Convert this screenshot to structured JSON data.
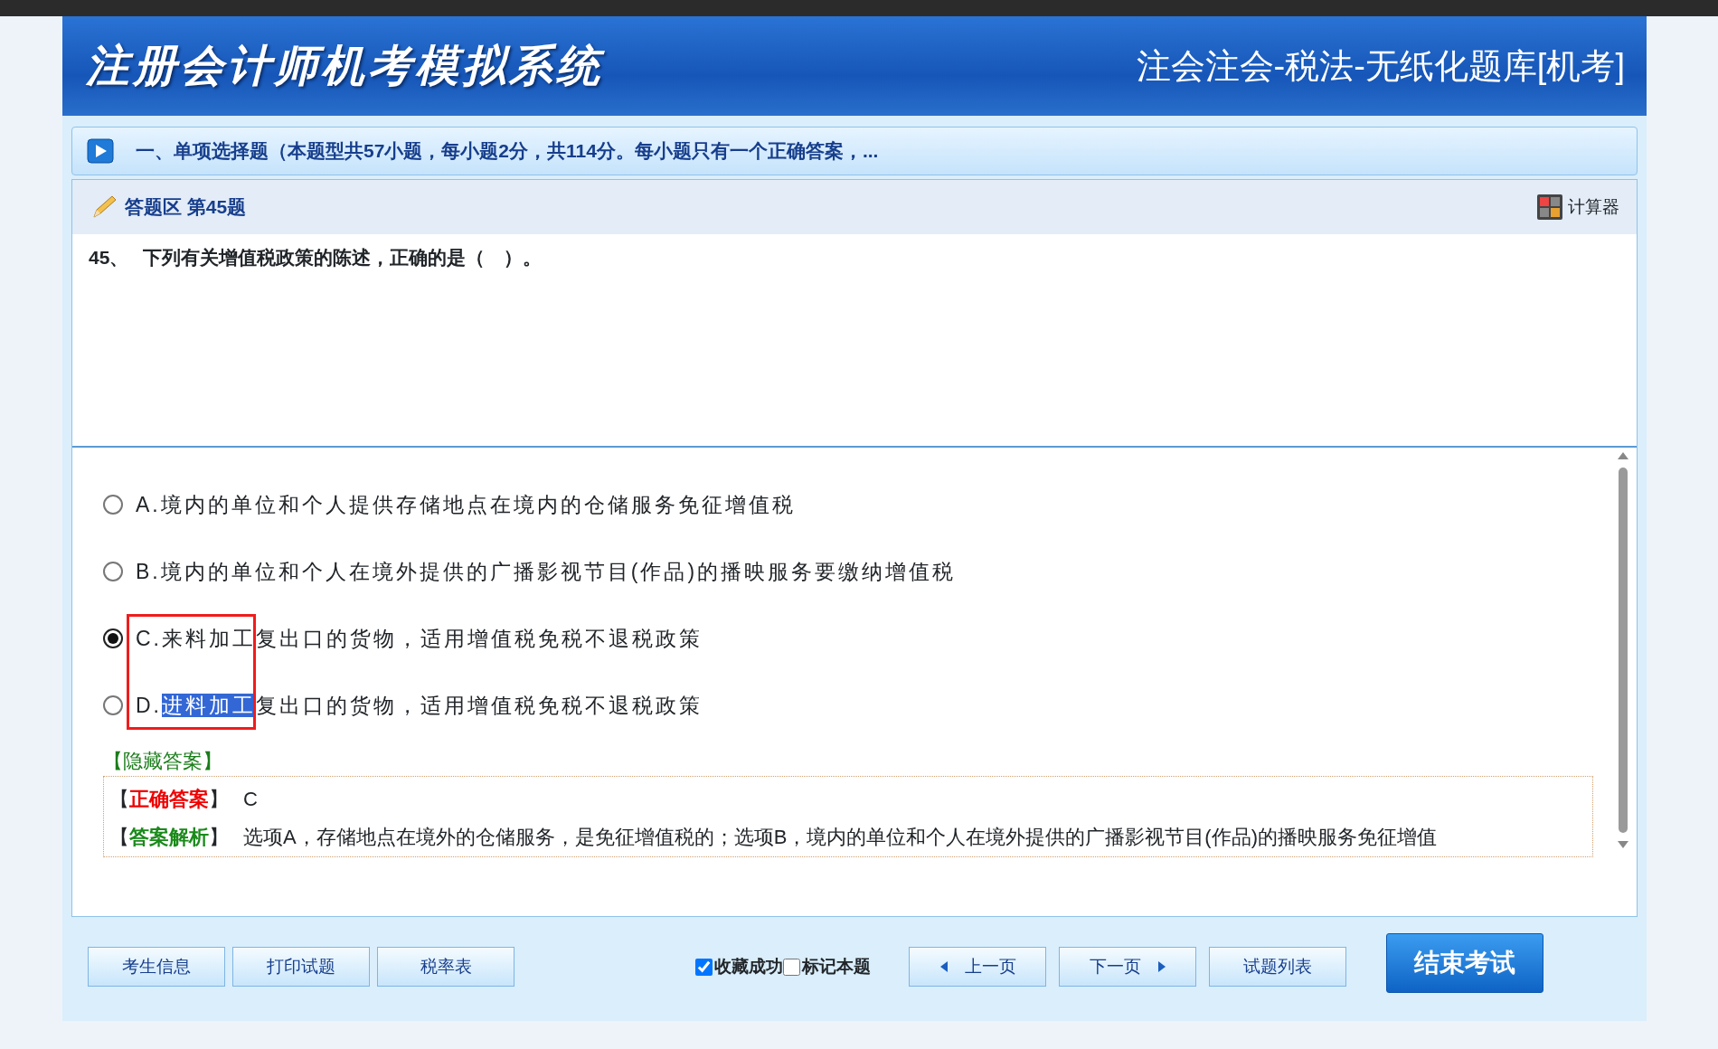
{
  "header": {
    "system_title": "注册会计师机考模拟系统",
    "exam_title": "注会注会-税法-无纸化题库[机考]"
  },
  "section": {
    "title": "一、单项选择题（本题型共57小题，每小题2分，共114分。每小题只有一个正确答案，..."
  },
  "answer_area": {
    "label": "答题区 第45题",
    "calculator": "计算器"
  },
  "question": {
    "number": "45、",
    "text": "下列有关增值税政策的陈述，正确的是（　）。"
  },
  "options": [
    {
      "letter": "A.",
      "text": "境内的单位和个人提供存储地点在境内的仓储服务免征增值税",
      "selected": false
    },
    {
      "letter": "B.",
      "text": "境内的单位和个人在境外提供的广播影视节目(作品)的播映服务要缴纳增值税",
      "selected": false
    },
    {
      "letter": "C.",
      "text": "来料加工复出口的货物，适用增值税免税不退税政策",
      "selected": true
    },
    {
      "letter": "D.",
      "highlighted": "进料加工",
      "text": "复出口的货物，适用增值税免税不退税政策",
      "selected": false
    }
  ],
  "hide_answer_link": "【隐藏答案】",
  "answer_lines": [
    {
      "kind": "correct",
      "bracket_open": "【",
      "label": "正确答案",
      "bracket_close": "】",
      "text": "C"
    },
    {
      "kind": "analysis",
      "bracket_open": "【",
      "label": "答案解析",
      "bracket_close": "】",
      "text": "选项A，存储地点在境外的仓储服务，是免征增值税的；选项B，境内的单位和个人在境外提供的广播影视节目(作品)的播映服务免征增值"
    }
  ],
  "left_buttons": [
    {
      "label": "考生信息"
    },
    {
      "label": "打印试题"
    },
    {
      "label": "税率表"
    }
  ],
  "checkboxes": [
    {
      "label": "收藏成功",
      "checked": true
    },
    {
      "label": "标记本题",
      "checked": false
    }
  ],
  "nav_buttons": [
    {
      "kind": "prev",
      "label": "上一页"
    },
    {
      "kind": "next",
      "label": "下一页"
    },
    {
      "kind": "plain",
      "label": "试题列表"
    }
  ],
  "finish_button": {
    "label": "结束考试"
  }
}
